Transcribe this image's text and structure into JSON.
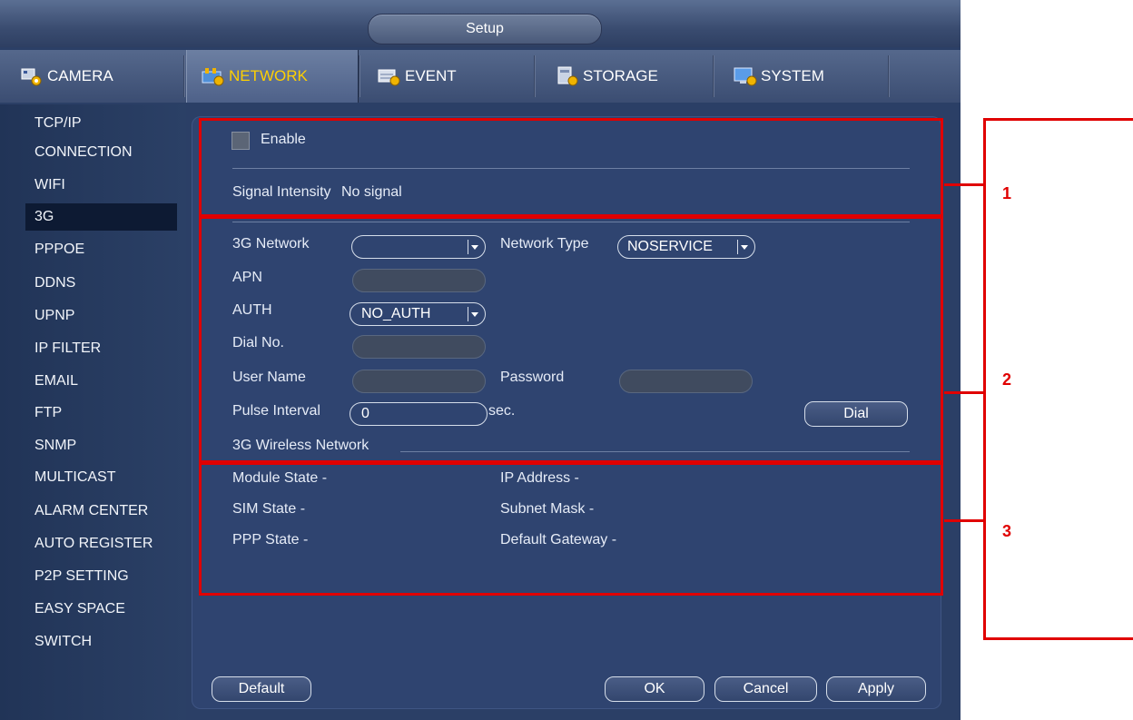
{
  "window": {
    "title": "Setup"
  },
  "tabs": [
    {
      "label": "CAMERA",
      "icon": "camera-gear-icon"
    },
    {
      "label": "NETWORK",
      "icon": "network-gear-icon",
      "active": true
    },
    {
      "label": "EVENT",
      "icon": "event-gear-icon"
    },
    {
      "label": "STORAGE",
      "icon": "storage-gear-icon"
    },
    {
      "label": "SYSTEM",
      "icon": "system-gear-icon"
    }
  ],
  "sidebar": {
    "items": [
      "TCP/IP",
      "CONNECTION",
      "WIFI",
      "3G",
      "PPPOE",
      "DDNS",
      "UPNP",
      "IP FILTER",
      "EMAIL",
      "FTP",
      "SNMP",
      "MULTICAST",
      "ALARM CENTER",
      "AUTO REGISTER",
      "P2P SETTING",
      "EASY SPACE",
      "SWITCH"
    ],
    "active": "3G"
  },
  "section1": {
    "enable_label": "Enable",
    "enable_checked": false,
    "signal_label": "Signal Intensity",
    "signal_value": "No signal"
  },
  "section2": {
    "network_label": "3G Network",
    "network_value": "",
    "network_type_label": "Network Type",
    "network_type_value": "NOSERVICE",
    "apn_label": "APN",
    "apn_value": "",
    "auth_label": "AUTH",
    "auth_value": "NO_AUTH",
    "dial_no_label": "Dial No.",
    "dial_no_value": "",
    "username_label": "User Name",
    "username_value": "",
    "password_label": "Password",
    "password_value": "",
    "pulse_label": "Pulse Interval",
    "pulse_value": "0",
    "pulse_unit": "sec.",
    "dial_button": "Dial",
    "wireless_heading": "3G Wireless Network"
  },
  "section3": {
    "module_state": "Module State  -",
    "sim_state": "SIM State  -",
    "ppp_state": "PPP State  -",
    "ip_address": "IP Address  -",
    "subnet_mask": "Subnet Mask  -",
    "default_gateway": "Default Gateway  -"
  },
  "footer": {
    "default_button": "Default",
    "ok_button": "OK",
    "cancel_button": "Cancel",
    "apply_button": "Apply"
  },
  "annotations": [
    "1",
    "2",
    "3"
  ],
  "colors": {
    "annotation": "#e00000",
    "active_tab_text": "#ffd000",
    "panel_bg": "#2f4470"
  }
}
